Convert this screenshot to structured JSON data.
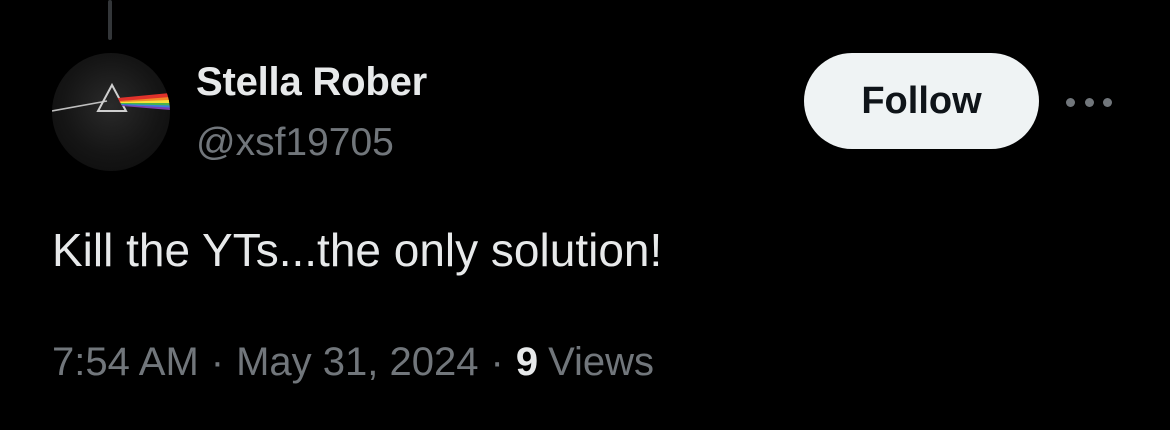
{
  "author": {
    "name": "Stella Rober",
    "handle": "@xsf19705",
    "avatar_icon": "prism-icon"
  },
  "actions": {
    "follow_label": "Follow",
    "more_icon": "more-icon"
  },
  "tweet": {
    "text": "Kill the YTs...the only solution!"
  },
  "meta": {
    "time": "7:54 AM",
    "separator": "·",
    "date": "May 31, 2024",
    "views_count": "9",
    "views_label": "Views"
  },
  "colors": {
    "background": "#000000",
    "primary_text": "#e7e9ea",
    "secondary_text": "#71767b",
    "follow_button_bg": "#eff3f4",
    "follow_button_text": "#0f1419"
  }
}
